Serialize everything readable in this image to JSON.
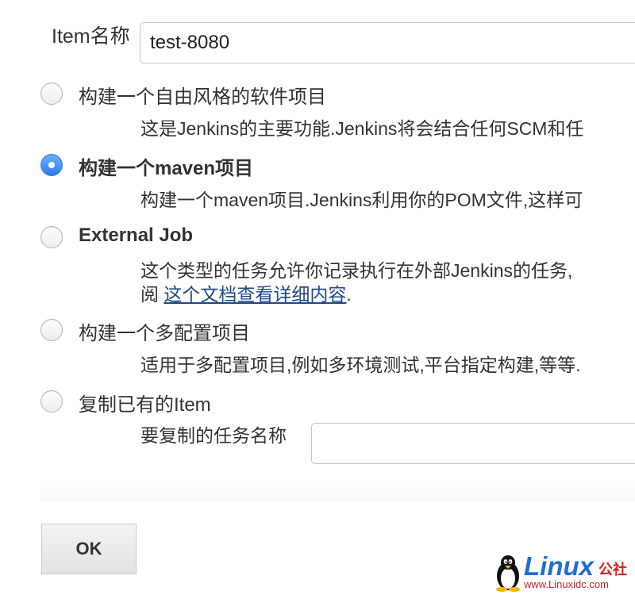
{
  "form": {
    "name_label": "Item名称",
    "name_value": "test-8080"
  },
  "options": [
    {
      "title": "构建一个自由风格的软件项目",
      "description": "这是Jenkins的主要功能.Jenkins将会结合任何SCM和任",
      "checked": false
    },
    {
      "title": "构建一个maven项目",
      "description": "构建一个maven项目.Jenkins利用你的POM文件,这样可",
      "checked": true
    },
    {
      "title": "External Job",
      "description_line1": "这个类型的任务允许你记录执行在外部Jenkins的任务,",
      "description_line2_prefix": "阅",
      "description_link": "这个文档查看详细内容",
      "description_line2_suffix": ".",
      "checked": false
    },
    {
      "title": "构建一个多配置项目",
      "description": "适用于多配置项目,例如多环境测试,平台指定构建,等等.",
      "checked": false
    },
    {
      "title": "复制已有的Item",
      "copy_label": "要复制的任务名称",
      "copy_value": "",
      "checked": false
    }
  ],
  "ok_label": "OK",
  "watermark": {
    "brand": "Linux",
    "suffix": "公社",
    "url": "www.Linuxidc.com",
    "icon": "tux-penguin-icon"
  },
  "colors": {
    "radio_checked": "#2c7be5",
    "link": "#204a87",
    "watermark_blue": "#1e6fd0",
    "watermark_red": "#d62020"
  }
}
